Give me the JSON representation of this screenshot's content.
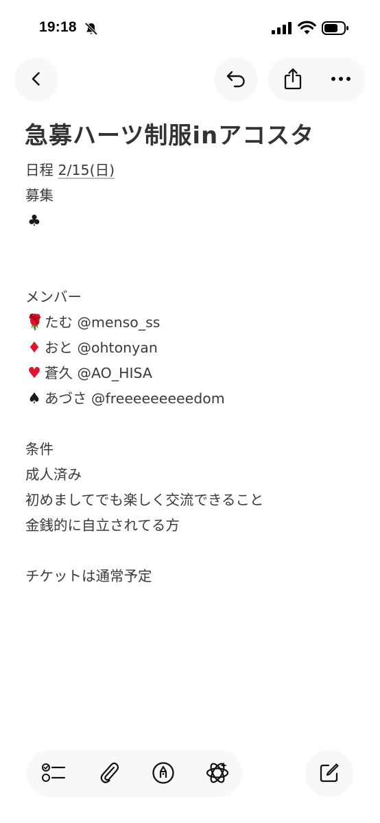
{
  "status_bar": {
    "time": "19:18"
  },
  "icons": {
    "back": "chevron-left-icon",
    "undo": "undo-icon",
    "share": "share-icon",
    "more": "ellipsis-icon",
    "checklist": "checklist-icon",
    "attachment": "paperclip-icon",
    "markup": "markup-pen-icon",
    "ai": "apple-intelligence-icon",
    "compose": "compose-icon"
  },
  "note": {
    "title": "急募ハーツ制服inアコスタ",
    "date_prefix": "日程 ",
    "date_value": "2/15(日)",
    "recruit_label": "募集",
    "recruit_suit": "♣",
    "members_label": "メンバー",
    "members": [
      {
        "emoji": "🌹",
        "text": "たむ @menso_ss"
      },
      {
        "emoji": "♦",
        "text": "おと @ohtonyan"
      },
      {
        "emoji": "♥",
        "text": "蒼久 @AO_HISA"
      },
      {
        "emoji": "♠",
        "text": "あづさ @freeeeeeeeedom"
      }
    ],
    "conditions_label": "条件",
    "conditions": [
      "成人済み",
      "初めましてでも楽しく交流できること",
      "金銭的に自立されてる方"
    ],
    "ticket_note": "チケットは通常予定"
  },
  "colors": {
    "text": "#333333",
    "button_bg": "#f8f8f8",
    "heart": "#e2132c",
    "diamond": "#e2132c"
  }
}
